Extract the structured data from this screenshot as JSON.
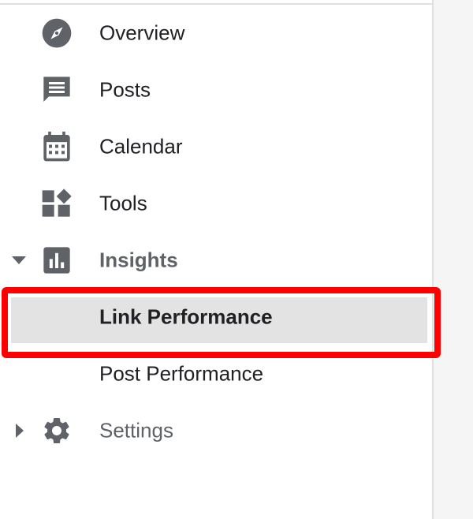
{
  "nav": {
    "overview": {
      "label": "Overview",
      "icon": "compass-icon"
    },
    "posts": {
      "label": "Posts",
      "icon": "comment-icon"
    },
    "calendar": {
      "label": "Calendar",
      "icon": "calendar-icon"
    },
    "tools": {
      "label": "Tools",
      "icon": "widgets-icon"
    },
    "insights": {
      "label": "Insights",
      "icon": "bar-chart-icon",
      "expanded": true
    },
    "link_performance": {
      "label": "Link Performance",
      "selected": true
    },
    "post_performance": {
      "label": "Post Performance"
    },
    "settings": {
      "label": "Settings",
      "icon": "gear-icon",
      "expanded": false
    }
  },
  "colors": {
    "icon": "#5f6368",
    "text": "#202124",
    "selected_bg": "#e3e3e3",
    "highlight_border": "#ff0000"
  }
}
